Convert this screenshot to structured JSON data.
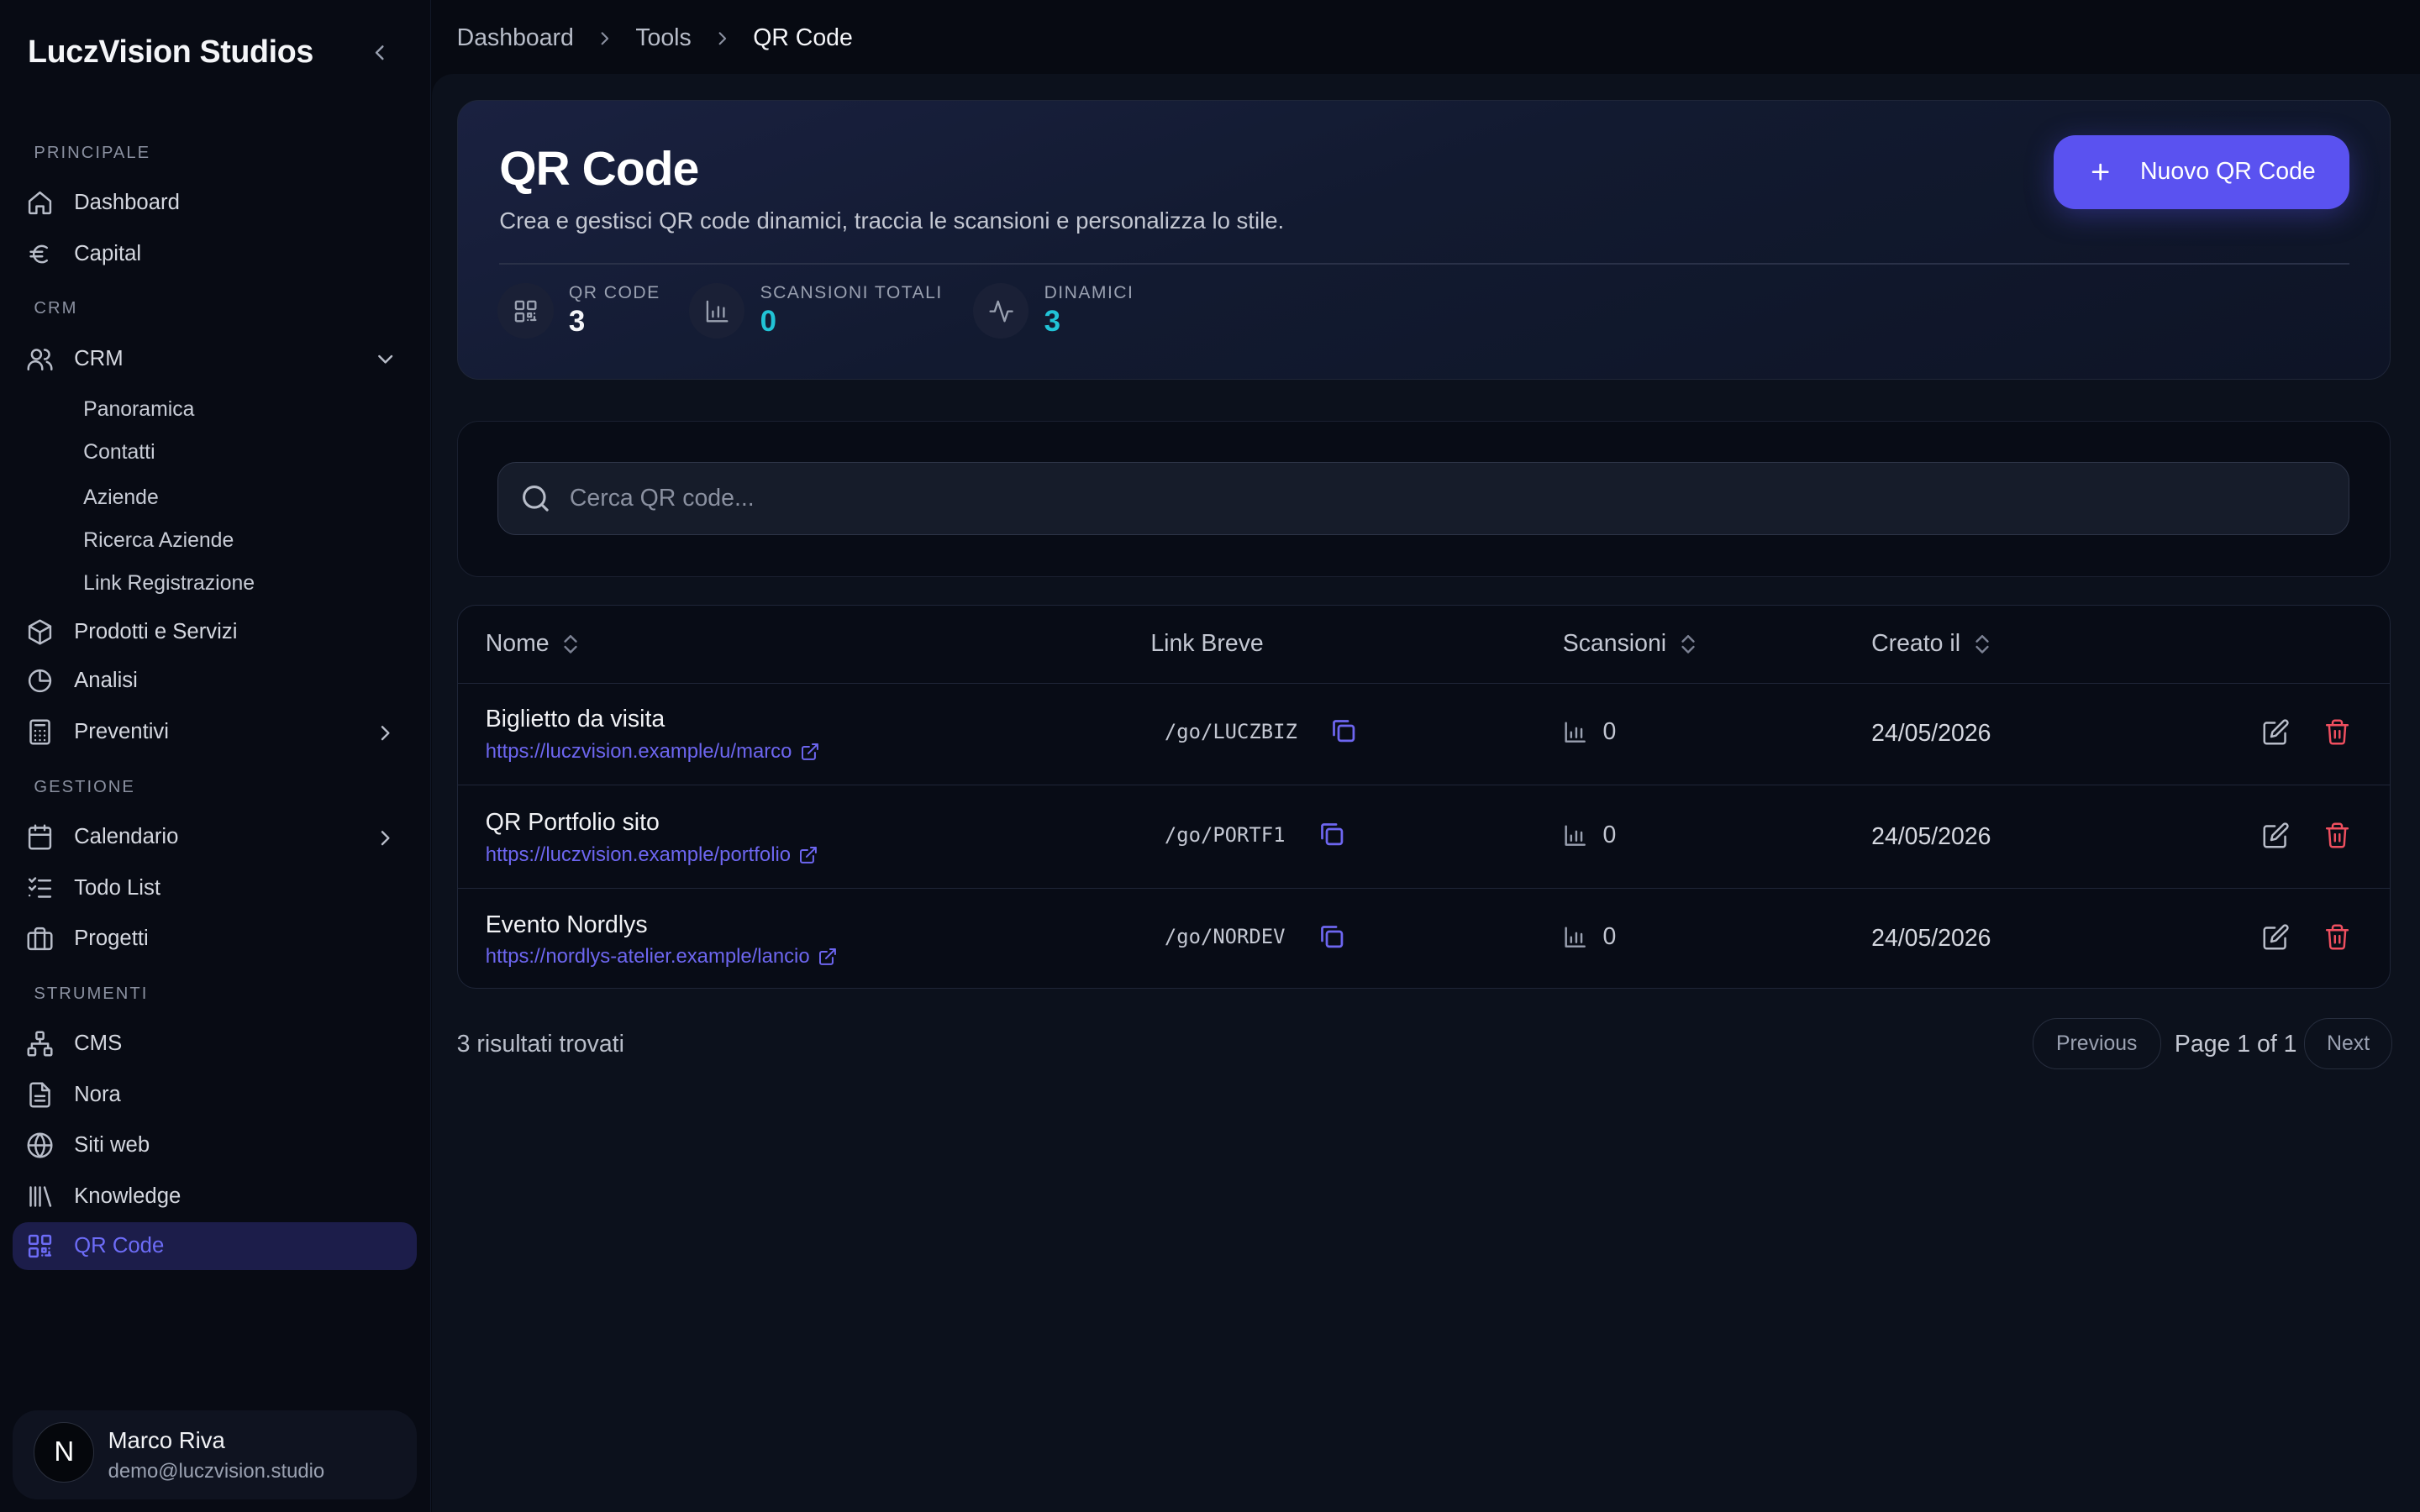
{
  "app": {
    "brand": "LuczVision Studios"
  },
  "sidebar": {
    "sections": {
      "principale": "PRINCIPALE",
      "crm": "CRM",
      "gestione": "GESTIONE",
      "strumenti": "STRUMENTI"
    },
    "items": {
      "dashboard": "Dashboard",
      "capital": "Capital",
      "crm": "CRM",
      "prodotti": "Prodotti e Servizi",
      "analisi": "Analisi",
      "preventivi": "Preventivi",
      "calendario": "Calendario",
      "todo": "Todo List",
      "progetti": "Progetti",
      "cms": "CMS",
      "nora": "Nora",
      "siti": "Siti web",
      "knowledge": "Knowledge",
      "qrcode": "QR Code"
    },
    "crm_sub": [
      "Panoramica",
      "Contatti",
      "Aziende",
      "Ricerca Aziende",
      "Link Registrazione"
    ],
    "user": {
      "initial": "N",
      "name": "Marco Riva",
      "email": "demo@luczvision.studio"
    }
  },
  "breadcrumb": [
    "Dashboard",
    "Tools",
    "QR Code"
  ],
  "hero": {
    "title": "QR Code",
    "subtitle": "Crea e gestisci QR code dinamici, traccia le scansioni e personalizza lo stile.",
    "new_button": "Nuovo QR Code",
    "stats": [
      {
        "label": "QR CODE",
        "value": "3"
      },
      {
        "label": "SCANSIONI TOTALI",
        "value": "0"
      },
      {
        "label": "DINAMICI",
        "value": "3"
      }
    ]
  },
  "search": {
    "placeholder": "Cerca QR code..."
  },
  "table": {
    "columns": [
      "Nome",
      "Link Breve",
      "Scansioni",
      "Creato il"
    ],
    "rows": [
      {
        "name": "Biglietto da visita",
        "url": "https://luczvision.example/u/marco",
        "short": "/go/LUCZBIZ",
        "scans": "0",
        "created": "24/05/2026"
      },
      {
        "name": "QR Portfolio sito",
        "url": "https://luczvision.example/portfolio",
        "short": "/go/PORTF1",
        "scans": "0",
        "created": "24/05/2026"
      },
      {
        "name": "Evento Nordlys",
        "url": "https://nordlys-atelier.example/lancio",
        "short": "/go/NORDEV",
        "scans": "0",
        "created": "24/05/2026"
      }
    ]
  },
  "footer": {
    "results": "3 risultati trovati",
    "previous": "Previous",
    "page_info": "Page 1 of 1",
    "next": "Next"
  },
  "colors": {
    "accent": "#5a52f0",
    "cyan": "#21c3d6",
    "danger": "#ef4f5f",
    "bg": "#070a12"
  }
}
